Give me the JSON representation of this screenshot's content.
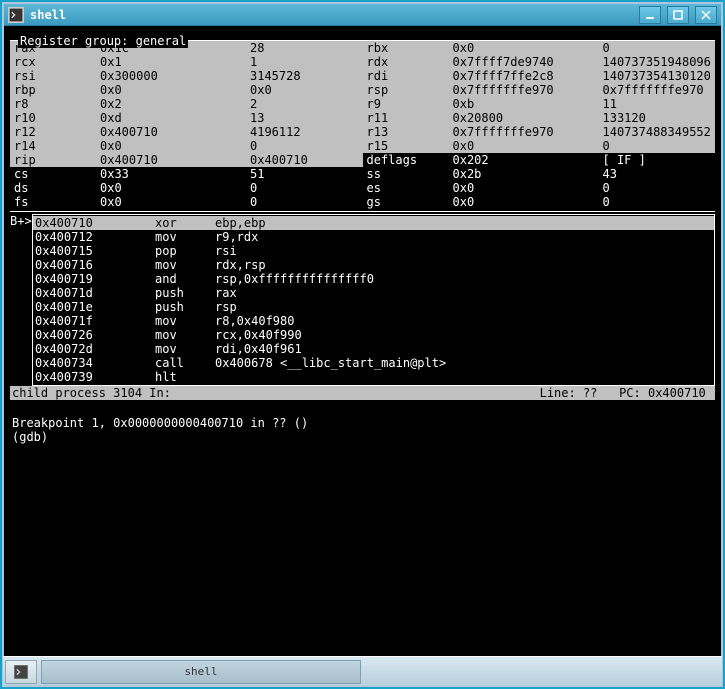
{
  "window": {
    "title": "shell"
  },
  "reg_header": "Register group: general",
  "regs_left": [
    {
      "n": "rax",
      "h": "0x1c",
      "d": "28",
      "hl": true
    },
    {
      "n": "rcx",
      "h": "0x1",
      "d": "1",
      "hl": true
    },
    {
      "n": "rsi",
      "h": "0x300000",
      "d": "3145728",
      "hl": true
    },
    {
      "n": "rbp",
      "h": "0x0",
      "d": "0x0",
      "hl": true
    },
    {
      "n": "r8",
      "h": "0x2",
      "d": "2",
      "hl": true
    },
    {
      "n": "r10",
      "h": "0xd",
      "d": "13",
      "hl": true
    },
    {
      "n": "r12",
      "h": "0x400710",
      "d": "4196112",
      "hl": true
    },
    {
      "n": "r14",
      "h": "0x0",
      "d": "0",
      "hl": true
    },
    {
      "n": "rip",
      "h": "0x400710",
      "d": "0x400710",
      "hl": true
    },
    {
      "n": "cs",
      "h": "0x33",
      "d": "51",
      "hl": false
    },
    {
      "n": "ds",
      "h": "0x0",
      "d": "0",
      "hl": false
    },
    {
      "n": "fs",
      "h": "0x0",
      "d": "0",
      "hl": false
    }
  ],
  "regs_right": [
    {
      "n": "rbx",
      "h": "0x0",
      "d": "0",
      "hl": true
    },
    {
      "n": "rdx",
      "h": "0x7ffff7de9740",
      "d": "140737351948096",
      "hl": true
    },
    {
      "n": "rdi",
      "h": "0x7ffff7ffe2c8",
      "d": "140737354130120",
      "hl": true
    },
    {
      "n": "rsp",
      "h": "0x7fffffffe970",
      "d": "0x7fffffffe970",
      "hl": true
    },
    {
      "n": "r9",
      "h": "0xb",
      "d": "11",
      "hl": true
    },
    {
      "n": "r11",
      "h": "0x20800",
      "d": "133120",
      "hl": true
    },
    {
      "n": "r13",
      "h": "0x7fffffffe970",
      "d": "140737488349552",
      "hl": true
    },
    {
      "n": "r15",
      "h": "0x0",
      "d": "0",
      "hl": true
    },
    {
      "n": "deflags",
      "h": "0x202",
      "d": "[ IF ]",
      "hl": false
    },
    {
      "n": "ss",
      "h": "0x2b",
      "d": "43",
      "hl": false
    },
    {
      "n": "es",
      "h": "0x0",
      "d": "0",
      "hl": false
    },
    {
      "n": "gs",
      "h": "0x0",
      "d": "0",
      "hl": false
    }
  ],
  "asm_marker": "B+>",
  "asm": [
    {
      "a": "0x400710",
      "m": "xor",
      "o": "ebp,ebp",
      "cur": true
    },
    {
      "a": "0x400712",
      "m": "mov",
      "o": "r9,rdx"
    },
    {
      "a": "0x400715",
      "m": "pop",
      "o": "rsi"
    },
    {
      "a": "0x400716",
      "m": "mov",
      "o": "rdx,rsp"
    },
    {
      "a": "0x400719",
      "m": "and",
      "o": "rsp,0xfffffffffffffff0"
    },
    {
      "a": "0x40071d",
      "m": "push",
      "o": "rax"
    },
    {
      "a": "0x40071e",
      "m": "push",
      "o": "rsp"
    },
    {
      "a": "0x40071f",
      "m": "mov",
      "o": "r8,0x40f980"
    },
    {
      "a": "0x400726",
      "m": "mov",
      "o": "rcx,0x40f990"
    },
    {
      "a": "0x40072d",
      "m": "mov",
      "o": "rdi,0x40f961"
    },
    {
      "a": "0x400734",
      "m": "call",
      "o": "0x400678 <__libc_start_main@plt>"
    },
    {
      "a": "0x400739",
      "m": "hlt",
      "o": ""
    }
  ],
  "status": {
    "left": "child process 3104 In:",
    "right": "Line: ??   PC: 0x400710 "
  },
  "gdb": {
    "bp": "Breakpoint 1, 0x0000000000400710 in ?? ()",
    "prompt": "(gdb) "
  },
  "taskbar": {
    "item": "shell"
  }
}
